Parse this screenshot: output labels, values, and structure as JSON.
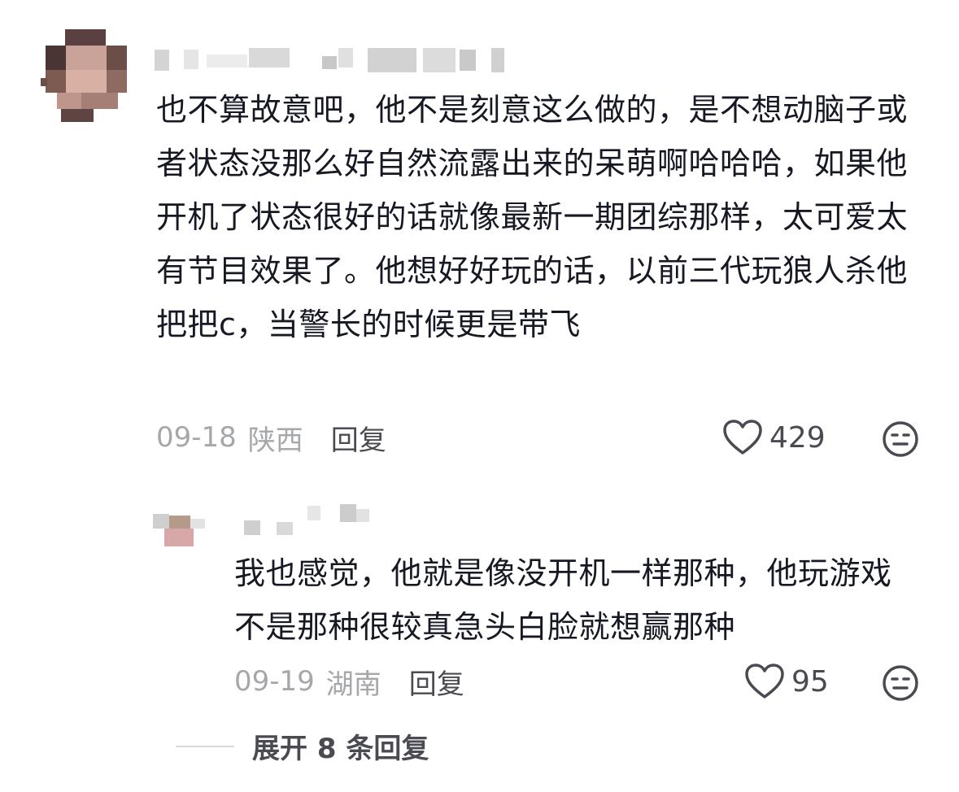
{
  "comments": [
    {
      "text": "也不算故意吧，他不是刻意这么做的，是不想动脑子或者状态没那么好自然流露出来的呆萌啊哈哈哈，如果他开机了状态很好的话就像最新一期团综那样，太可爱太有节目效果了。他想好好玩的话，以前三代玩狼人杀他把把c，当警长的时候更是带飞",
      "date": "09-18",
      "location": "陕西",
      "reply_label": "回复",
      "like_count": "429",
      "like_icon": "heart-outline-icon",
      "dislike_icon": "neutral-face-icon"
    },
    {
      "text": "我也感觉，他就是像没开机一样那种，他玩游戏不是那种很较真急头白脸就想赢那种",
      "date": "09-19",
      "location": "湖南",
      "reply_label": "回复",
      "like_count": "95",
      "like_icon": "heart-outline-icon",
      "dislike_icon": "neutral-face-icon"
    }
  ],
  "expand_label": "展开 8 条回复",
  "colors": {
    "text_primary": "#161823",
    "text_secondary": "#a6a7ab",
    "action": "#4a4b52"
  }
}
